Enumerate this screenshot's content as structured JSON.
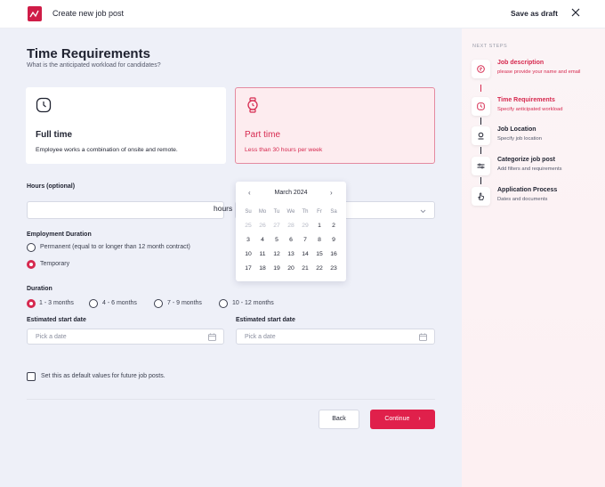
{
  "header": {
    "title": "Create new job post",
    "save_draft": "Save as draft"
  },
  "page": {
    "title": "Time Requirements",
    "subtitle": "What is the anticipated workload for candidates?"
  },
  "cards": [
    {
      "title": "Full time",
      "desc": "Employee works a combination of onsite and remote.",
      "selected": false
    },
    {
      "title": "Part time",
      "desc": "Less than 30 hours per week",
      "selected": true
    }
  ],
  "hours": {
    "label": "Hours (optional)",
    "value": "",
    "unit": "hours"
  },
  "employment": {
    "label": "Employment Duration",
    "options": [
      "Permanent (equal to or longer than 12 month contract)",
      "Temporary"
    ],
    "selected": "Temporary"
  },
  "duration": {
    "label": "Duration",
    "options": [
      "1 - 3 months",
      "4 - 6 months",
      "7 - 9 months",
      "10 - 12 months"
    ],
    "selected": "1 - 3 months"
  },
  "start_dates": [
    {
      "label": "Estimated start date",
      "placeholder": "Pick a date"
    },
    {
      "label": "Estimated start date",
      "placeholder": "Pick a date"
    }
  ],
  "calendar": {
    "month": "March 2024",
    "prev": "‹",
    "next": "›",
    "weekdays": [
      "Su",
      "Mo",
      "Tu",
      "We",
      "Th",
      "Fr",
      "Sa"
    ],
    "weeks": [
      [
        "25",
        "26",
        "27",
        "28",
        "29",
        "1",
        "2"
      ],
      [
        "3",
        "4",
        "5",
        "6",
        "7",
        "8",
        "9"
      ],
      [
        "10",
        "11",
        "12",
        "13",
        "14",
        "15",
        "16"
      ],
      [
        "17",
        "18",
        "19",
        "20",
        "21",
        "22",
        "23"
      ]
    ]
  },
  "default_checkbox": {
    "label": "Set this as default values for future job posts.",
    "checked": false
  },
  "buttons": {
    "back": "Back",
    "continue": "Continue",
    "continue_icon": "›"
  },
  "sidebar": {
    "heading": "NEXT STEPS",
    "steps": [
      {
        "title": "Job description",
        "desc": "please provide your name and email",
        "icon": "document-icon",
        "active": true
      },
      {
        "title": "Time Requirements",
        "desc": "Specify anticipated workload",
        "icon": "clock-icon",
        "active": true
      },
      {
        "title": "Job Location",
        "desc": "Specify job location",
        "icon": "location-pin-icon",
        "active": false
      },
      {
        "title": "Categorize job post",
        "desc": "Add filters and requirements",
        "icon": "filter-icon",
        "active": false
      },
      {
        "title": "Application Process",
        "desc": "Dates and documents",
        "icon": "hand-pointer-icon",
        "active": false
      }
    ]
  },
  "colors": {
    "accent": "#e0204b",
    "accent_text": "#d6294f",
    "card_selected_bg": "#fdecef",
    "main_bg": "#eef0f8"
  }
}
